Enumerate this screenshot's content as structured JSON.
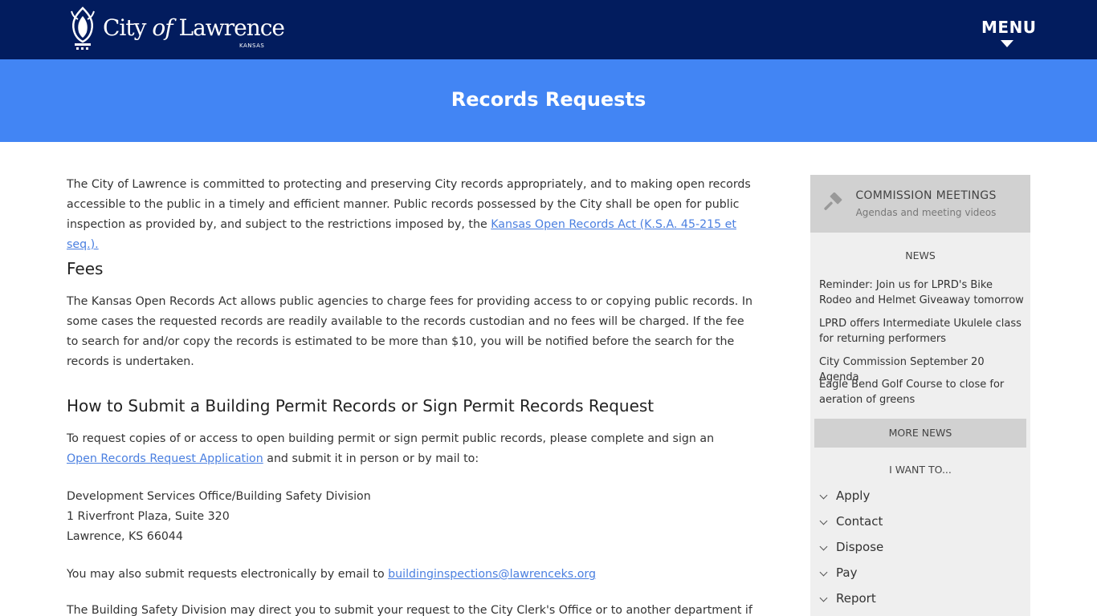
{
  "header": {
    "logo_text_city": "City",
    "logo_text_of": "of",
    "logo_text_name": "Lawrence",
    "logo_state": "KANSAS",
    "menu_label": "MENU"
  },
  "banner": {
    "title": "Records Requests"
  },
  "main": {
    "intro_text": "The City of Lawrence is committed to protecting and preserving City records appropriately, and to making open records accessible to the public in a timely and efficient manner. Public records possessed by the City shall be open for public inspection as provided by, and subject to the restrictions imposed by, the ",
    "intro_link": "Kansas Open Records Act (K.S.A. 45-215 et seq.).",
    "fees_heading": "Fees",
    "fees_text": "The Kansas Open Records Act allows public agencies to charge fees for providing access to or copying public records. In some cases the requested records are readily available to the records custodian and no fees will be charged. If the fee to search for and/or copy the records is estimated to be more than $10, you will be notified before the search for the records is undertaken.",
    "how_heading": "How to Submit a Building Permit Records or Sign Permit Records Request",
    "how_text_before": "To request copies of or access to open building permit or sign permit public records, please complete and sign an ",
    "how_link": "Open Records Request Application",
    "how_text_after": " and submit it in person or by mail to:",
    "address_line1": "Development Services Office/Building Safety Division",
    "address_line2": "1 Riverfront Plaza, Suite 320",
    "address_line3": "Lawrence, KS 66044",
    "email_text": "You may also submit requests electronically by email to ",
    "email_link": "buildinginspections@lawrenceks.org",
    "direct_text": "The Building Safety Division may direct you to submit your request to the City Clerk's Office or to another department if the"
  },
  "sidebar": {
    "commission_title": "COMMISSION MEETINGS",
    "commission_sub": "Agendas and meeting videos",
    "news_heading": "NEWS",
    "news": [
      "Reminder: Join us for LPRD's Bike Rodeo and Helmet Giveaway tomorrow",
      "LPRD offers Intermediate Ukulele class for returning performers",
      "City Commission September 20 Agenda",
      "Eagle Bend Golf Course to close for aeration of greens"
    ],
    "more_news": "MORE NEWS",
    "iwant_heading": "I WANT TO...",
    "iwant": [
      "Apply",
      "Contact",
      "Dispose",
      "Pay",
      "Report"
    ]
  },
  "colors": {
    "header_bg": "#021c5e",
    "banner_bg": "#4285f4",
    "link": "#4a7fe0",
    "sidebar_bg": "#efefef",
    "sidebar_accent": "#d1d1d1"
  }
}
